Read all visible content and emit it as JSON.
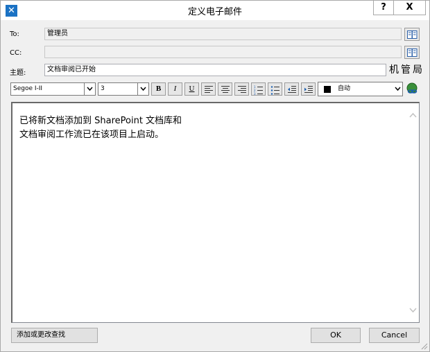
{
  "window": {
    "title": "定义电子邮件",
    "app_icon": "tools-icon",
    "help_label": "?",
    "close_label": "X"
  },
  "to": {
    "label": "To:",
    "value": "管理员",
    "book_icon": "address-book-icon"
  },
  "cc": {
    "label": "CC:",
    "value": "",
    "book_icon": "address-book-icon"
  },
  "subject": {
    "label": "主题:",
    "value": "文档审阅已开始",
    "side_text": "机管局"
  },
  "toolbar": {
    "font_name": "Segoe I-II",
    "font_size": "3",
    "bold_label": "B",
    "italic_label": "I",
    "underline_label": "U",
    "color_label": "自动",
    "color_value": "#000000"
  },
  "body": {
    "line1": "已将新文档添加到 SharePoint 文档库和",
    "line2": "文档审阅工作流已在该项目上启动。"
  },
  "buttons": {
    "address_book": "添加或更改查找",
    "ok": "OK",
    "cancel": "Cancel"
  }
}
